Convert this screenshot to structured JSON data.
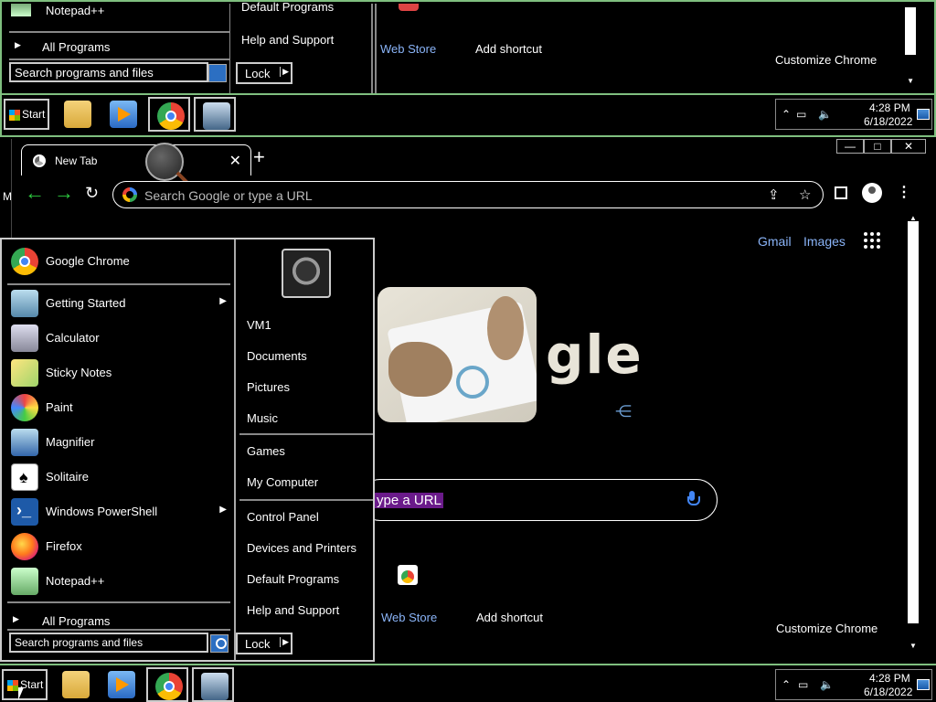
{
  "zoom": {
    "notepad_label": "Notepad++",
    "all_programs": "All Programs",
    "default_programs": "Default Programs",
    "help_support": "Help and Support",
    "search_placeholder": "Search programs and files",
    "lock": "Lock",
    "web_store": "Web Store",
    "add_shortcut": "Add shortcut",
    "customize": "Customize Chrome",
    "start": "Start",
    "time": "4:28 PM",
    "date": "6/18/2022"
  },
  "chrome": {
    "tab_title": "New Tab",
    "omnibox_placeholder": "Search Google or type a URL",
    "gmail": "Gmail",
    "images": "Images",
    "logo_text": "gle",
    "search_hint": "ype a URL",
    "web_store": "Web Store",
    "add_shortcut": "Add shortcut",
    "customize": "Customize Chrome",
    "side_letter": "M"
  },
  "start_menu": {
    "pinned": "Google Chrome",
    "items": [
      {
        "label": "Getting Started",
        "arrow": "▶"
      },
      {
        "label": "Calculator",
        "arrow": ""
      },
      {
        "label": "Sticky Notes",
        "arrow": ""
      },
      {
        "label": "Paint",
        "arrow": ""
      },
      {
        "label": "Magnifier",
        "arrow": ""
      },
      {
        "label": "Solitaire",
        "arrow": ""
      },
      {
        "label": "Windows PowerShell",
        "arrow": "▶"
      },
      {
        "label": "Firefox",
        "arrow": ""
      },
      {
        "label": "Notepad++",
        "arrow": ""
      }
    ],
    "all_programs": "All Programs",
    "right": {
      "user": "VM1",
      "documents": "Documents",
      "pictures": "Pictures",
      "music": "Music",
      "games": "Games",
      "computer": "My Computer",
      "control_panel": "Control Panel",
      "devices": "Devices and Printers",
      "default_programs": "Default Programs",
      "help": "Help and Support"
    },
    "search_placeholder": "Search programs and files",
    "lock": "Lock"
  },
  "taskbar": {
    "start": "Start",
    "time": "4:28 PM",
    "date": "6/18/2022"
  },
  "colors": {
    "link": "#8ab4f8",
    "nav_green": "#2ecc40",
    "frame_green": "#7fbf7f"
  }
}
